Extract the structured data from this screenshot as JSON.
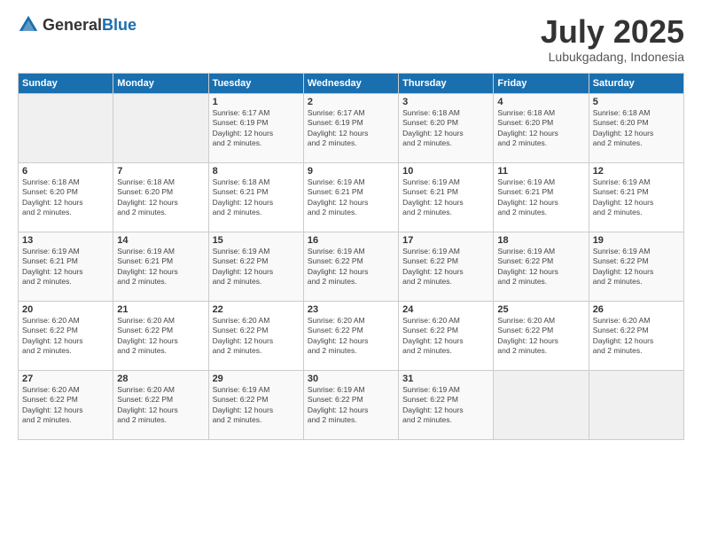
{
  "header": {
    "logo_general": "General",
    "logo_blue": "Blue",
    "month_title": "July 2025",
    "location": "Lubukgadang, Indonesia"
  },
  "days_of_week": [
    "Sunday",
    "Monday",
    "Tuesday",
    "Wednesday",
    "Thursday",
    "Friday",
    "Saturday"
  ],
  "weeks": [
    [
      {
        "day": "",
        "content": ""
      },
      {
        "day": "",
        "content": ""
      },
      {
        "day": "1",
        "content": "Sunrise: 6:17 AM\nSunset: 6:19 PM\nDaylight: 12 hours\nand 2 minutes."
      },
      {
        "day": "2",
        "content": "Sunrise: 6:17 AM\nSunset: 6:19 PM\nDaylight: 12 hours\nand 2 minutes."
      },
      {
        "day": "3",
        "content": "Sunrise: 6:18 AM\nSunset: 6:20 PM\nDaylight: 12 hours\nand 2 minutes."
      },
      {
        "day": "4",
        "content": "Sunrise: 6:18 AM\nSunset: 6:20 PM\nDaylight: 12 hours\nand 2 minutes."
      },
      {
        "day": "5",
        "content": "Sunrise: 6:18 AM\nSunset: 6:20 PM\nDaylight: 12 hours\nand 2 minutes."
      }
    ],
    [
      {
        "day": "6",
        "content": "Sunrise: 6:18 AM\nSunset: 6:20 PM\nDaylight: 12 hours\nand 2 minutes."
      },
      {
        "day": "7",
        "content": "Sunrise: 6:18 AM\nSunset: 6:20 PM\nDaylight: 12 hours\nand 2 minutes."
      },
      {
        "day": "8",
        "content": "Sunrise: 6:18 AM\nSunset: 6:21 PM\nDaylight: 12 hours\nand 2 minutes."
      },
      {
        "day": "9",
        "content": "Sunrise: 6:19 AM\nSunset: 6:21 PM\nDaylight: 12 hours\nand 2 minutes."
      },
      {
        "day": "10",
        "content": "Sunrise: 6:19 AM\nSunset: 6:21 PM\nDaylight: 12 hours\nand 2 minutes."
      },
      {
        "day": "11",
        "content": "Sunrise: 6:19 AM\nSunset: 6:21 PM\nDaylight: 12 hours\nand 2 minutes."
      },
      {
        "day": "12",
        "content": "Sunrise: 6:19 AM\nSunset: 6:21 PM\nDaylight: 12 hours\nand 2 minutes."
      }
    ],
    [
      {
        "day": "13",
        "content": "Sunrise: 6:19 AM\nSunset: 6:21 PM\nDaylight: 12 hours\nand 2 minutes."
      },
      {
        "day": "14",
        "content": "Sunrise: 6:19 AM\nSunset: 6:21 PM\nDaylight: 12 hours\nand 2 minutes."
      },
      {
        "day": "15",
        "content": "Sunrise: 6:19 AM\nSunset: 6:22 PM\nDaylight: 12 hours\nand 2 minutes."
      },
      {
        "day": "16",
        "content": "Sunrise: 6:19 AM\nSunset: 6:22 PM\nDaylight: 12 hours\nand 2 minutes."
      },
      {
        "day": "17",
        "content": "Sunrise: 6:19 AM\nSunset: 6:22 PM\nDaylight: 12 hours\nand 2 minutes."
      },
      {
        "day": "18",
        "content": "Sunrise: 6:19 AM\nSunset: 6:22 PM\nDaylight: 12 hours\nand 2 minutes."
      },
      {
        "day": "19",
        "content": "Sunrise: 6:19 AM\nSunset: 6:22 PM\nDaylight: 12 hours\nand 2 minutes."
      }
    ],
    [
      {
        "day": "20",
        "content": "Sunrise: 6:20 AM\nSunset: 6:22 PM\nDaylight: 12 hours\nand 2 minutes."
      },
      {
        "day": "21",
        "content": "Sunrise: 6:20 AM\nSunset: 6:22 PM\nDaylight: 12 hours\nand 2 minutes."
      },
      {
        "day": "22",
        "content": "Sunrise: 6:20 AM\nSunset: 6:22 PM\nDaylight: 12 hours\nand 2 minutes."
      },
      {
        "day": "23",
        "content": "Sunrise: 6:20 AM\nSunset: 6:22 PM\nDaylight: 12 hours\nand 2 minutes."
      },
      {
        "day": "24",
        "content": "Sunrise: 6:20 AM\nSunset: 6:22 PM\nDaylight: 12 hours\nand 2 minutes."
      },
      {
        "day": "25",
        "content": "Sunrise: 6:20 AM\nSunset: 6:22 PM\nDaylight: 12 hours\nand 2 minutes."
      },
      {
        "day": "26",
        "content": "Sunrise: 6:20 AM\nSunset: 6:22 PM\nDaylight: 12 hours\nand 2 minutes."
      }
    ],
    [
      {
        "day": "27",
        "content": "Sunrise: 6:20 AM\nSunset: 6:22 PM\nDaylight: 12 hours\nand 2 minutes."
      },
      {
        "day": "28",
        "content": "Sunrise: 6:20 AM\nSunset: 6:22 PM\nDaylight: 12 hours\nand 2 minutes."
      },
      {
        "day": "29",
        "content": "Sunrise: 6:19 AM\nSunset: 6:22 PM\nDaylight: 12 hours\nand 2 minutes."
      },
      {
        "day": "30",
        "content": "Sunrise: 6:19 AM\nSunset: 6:22 PM\nDaylight: 12 hours\nand 2 minutes."
      },
      {
        "day": "31",
        "content": "Sunrise: 6:19 AM\nSunset: 6:22 PM\nDaylight: 12 hours\nand 2 minutes."
      },
      {
        "day": "",
        "content": ""
      },
      {
        "day": "",
        "content": ""
      }
    ]
  ]
}
